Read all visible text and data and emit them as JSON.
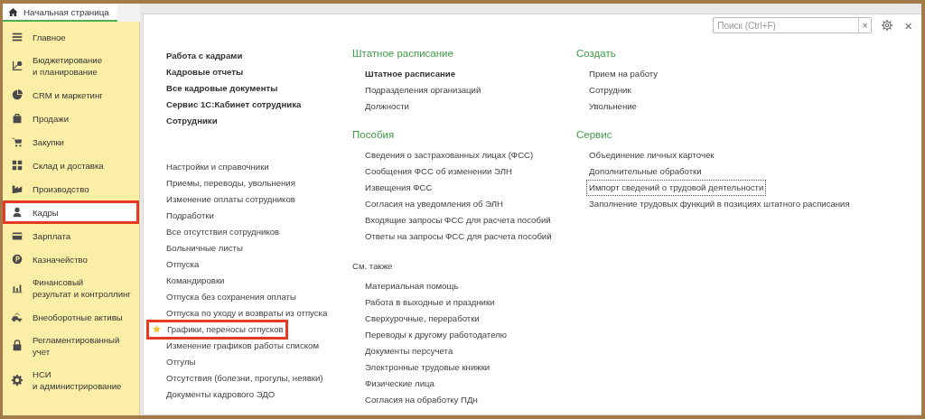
{
  "home_tab": {
    "label": "Начальная страница",
    "selected": true
  },
  "sidebar": {
    "items": [
      {
        "label": "Главное",
        "selected": false,
        "highlighted": false
      },
      {
        "label": "Бюджетирование\nи планирование",
        "selected": false,
        "highlighted": false
      },
      {
        "label": "CRM и маркетинг",
        "selected": false,
        "highlighted": false
      },
      {
        "label": "Продажи",
        "selected": false,
        "highlighted": false
      },
      {
        "label": "Закупки",
        "selected": false,
        "highlighted": false
      },
      {
        "label": "Склад и доставка",
        "selected": false,
        "highlighted": false
      },
      {
        "label": "Производство",
        "selected": false,
        "highlighted": false
      },
      {
        "label": "Кадры",
        "selected": true,
        "highlighted": true
      },
      {
        "label": "Зарплата",
        "selected": false,
        "highlighted": false
      },
      {
        "label": "Казначейство",
        "selected": false,
        "highlighted": false
      },
      {
        "label": "Финансовый\nрезультат и контроллинг",
        "selected": false,
        "highlighted": false
      },
      {
        "label": "Внеоборотные активы",
        "selected": false,
        "highlighted": false
      },
      {
        "label": "Регламентированный\nучет",
        "selected": false,
        "highlighted": false
      },
      {
        "label": "НСИ\nи администрирование",
        "selected": false,
        "highlighted": false
      }
    ]
  },
  "search": {
    "placeholder": "Поиск (Ctrl+F)",
    "clear": "×"
  },
  "close": "×",
  "columns": [
    {
      "sections": [
        {
          "items": [
            {
              "label": "Работа с кадрами",
              "bold": true,
              "favorite": false,
              "highlighted": false,
              "focused": false
            },
            {
              "label": "Кадровые отчеты",
              "bold": true,
              "favorite": false,
              "highlighted": false,
              "focused": false
            },
            {
              "label": "Все кадровые документы",
              "bold": true,
              "favorite": false,
              "highlighted": false,
              "focused": false
            },
            {
              "label": "Сервис 1С:Кабинет сотрудника",
              "bold": true,
              "favorite": false,
              "highlighted": false,
              "focused": false
            },
            {
              "label": "Сотрудники",
              "bold": true,
              "favorite": false,
              "highlighted": false,
              "focused": false
            }
          ]
        },
        {
          "items": [
            {
              "label": "Настройки и справочники",
              "bold": false,
              "favorite": false,
              "highlighted": false,
              "focused": false
            },
            {
              "label": "Приемы, переводы, увольнения",
              "bold": false,
              "favorite": false,
              "highlighted": false,
              "focused": false
            },
            {
              "label": "Изменение оплаты сотрудников",
              "bold": false,
              "favorite": false,
              "highlighted": false,
              "focused": false
            },
            {
              "label": "Подработки",
              "bold": false,
              "favorite": false,
              "highlighted": false,
              "focused": false
            },
            {
              "label": "Все отсутствия сотрудников",
              "bold": false,
              "favorite": false,
              "highlighted": false,
              "focused": false
            },
            {
              "label": "Больничные листы",
              "bold": false,
              "favorite": false,
              "highlighted": false,
              "focused": false
            },
            {
              "label": "Отпуска",
              "bold": false,
              "favorite": false,
              "highlighted": false,
              "focused": false
            },
            {
              "label": "Командировки",
              "bold": false,
              "favorite": false,
              "highlighted": false,
              "focused": false
            },
            {
              "label": "Отпуска без сохранения оплаты",
              "bold": false,
              "favorite": false,
              "highlighted": false,
              "focused": false
            },
            {
              "label": "Отпуска по уходу и возвраты из отпуска",
              "bold": false,
              "favorite": false,
              "highlighted": false,
              "focused": false
            },
            {
              "label": "Графики, переносы отпусков",
              "bold": false,
              "favorite": true,
              "highlighted": true,
              "focused": false
            },
            {
              "label": "Изменение графиков работы списком",
              "bold": false,
              "favorite": false,
              "highlighted": false,
              "focused": false
            },
            {
              "label": "Отгулы",
              "bold": false,
              "favorite": false,
              "highlighted": false,
              "focused": false
            },
            {
              "label": "Отсутствия (болезни, прогулы, неявки)",
              "bold": false,
              "favorite": false,
              "highlighted": false,
              "focused": false
            },
            {
              "label": "Документы кадрового ЭДО",
              "bold": false,
              "favorite": false,
              "highlighted": false,
              "focused": false
            }
          ]
        }
      ]
    },
    {
      "sections": [
        {
          "title": "Штатное расписание",
          "kind": "group",
          "items": [
            {
              "label": "Штатное расписание",
              "bold": true,
              "favorite": false,
              "highlighted": false,
              "focused": false
            },
            {
              "label": "Подразделения организаций",
              "bold": false,
              "favorite": false,
              "highlighted": false,
              "focused": false
            },
            {
              "label": "Должности",
              "bold": false,
              "favorite": false,
              "highlighted": false,
              "focused": false
            }
          ]
        },
        {
          "title": "Пособия",
          "kind": "group",
          "items": [
            {
              "label": "Сведения о застрахованных лицах (ФСС)",
              "bold": false,
              "favorite": false,
              "highlighted": false,
              "focused": false
            },
            {
              "label": "Сообщения ФСС об изменении ЭЛН",
              "bold": false,
              "favorite": false,
              "highlighted": false,
              "focused": false
            },
            {
              "label": "Извещения ФСС",
              "bold": false,
              "favorite": false,
              "highlighted": false,
              "focused": false
            },
            {
              "label": "Согласия на уведомления об ЭЛН",
              "bold": false,
              "favorite": false,
              "highlighted": false,
              "focused": false
            },
            {
              "label": "Входящие запросы ФСС для расчета пособий",
              "bold": false,
              "favorite": false,
              "highlighted": false,
              "focused": false
            },
            {
              "label": "Ответы на запросы ФСС для расчета пособий",
              "bold": false,
              "favorite": false,
              "highlighted": false,
              "focused": false
            }
          ]
        },
        {
          "title": "См. также",
          "kind": "see_also",
          "items": [
            {
              "label": "Материальная помощь",
              "bold": false,
              "favorite": false,
              "highlighted": false,
              "focused": false
            },
            {
              "label": "Работа в выходные и праздники",
              "bold": false,
              "favorite": false,
              "highlighted": false,
              "focused": false
            },
            {
              "label": "Сверхурочные, переработки",
              "bold": false,
              "favorite": false,
              "highlighted": false,
              "focused": false
            },
            {
              "label": "Переводы к другому работодателю",
              "bold": false,
              "favorite": false,
              "highlighted": false,
              "focused": false
            },
            {
              "label": "Документы персучета",
              "bold": false,
              "favorite": false,
              "highlighted": false,
              "focused": false
            },
            {
              "label": "Электронные трудовые книжки",
              "bold": false,
              "favorite": false,
              "highlighted": false,
              "focused": false
            },
            {
              "label": "Физические лица",
              "bold": false,
              "favorite": false,
              "highlighted": false,
              "focused": false
            },
            {
              "label": "Согласия на обработку ПДн",
              "bold": false,
              "favorite": false,
              "highlighted": false,
              "focused": false
            }
          ]
        }
      ]
    },
    {
      "sections": [
        {
          "title": "Создать",
          "kind": "group",
          "items": [
            {
              "label": "Прием на работу",
              "bold": false,
              "favorite": false,
              "highlighted": false,
              "focused": false
            },
            {
              "label": "Сотрудник",
              "bold": false,
              "favorite": false,
              "highlighted": false,
              "focused": false
            },
            {
              "label": "Увольнение",
              "bold": false,
              "favorite": false,
              "highlighted": false,
              "focused": false
            }
          ]
        },
        {
          "title": "Сервис",
          "kind": "group",
          "items": [
            {
              "label": "Объединение личных карточек",
              "bold": false,
              "favorite": false,
              "highlighted": false,
              "focused": false
            },
            {
              "label": "Дополнительные обработки",
              "bold": false,
              "favorite": false,
              "highlighted": false,
              "focused": false
            },
            {
              "label": "Импорт сведений о трудовой деятельности",
              "bold": false,
              "favorite": false,
              "highlighted": false,
              "focused": true
            },
            {
              "label": "Заполнение трудовых функций в позициях штатного расписания",
              "bold": false,
              "favorite": false,
              "highlighted": false,
              "focused": false
            }
          ]
        }
      ]
    }
  ]
}
